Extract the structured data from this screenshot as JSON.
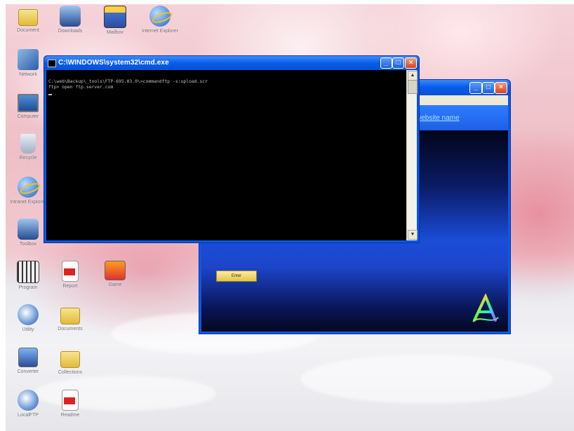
{
  "desktop": {
    "icons": [
      {
        "name": "folder-icon",
        "label": "Document"
      },
      {
        "name": "tool-icon",
        "label": "Downloads"
      },
      {
        "name": "msg-icon",
        "label": "Mailbox"
      },
      {
        "name": "ie-icon",
        "label": "Internet Explorer"
      },
      {
        "name": "network-icon",
        "label": "Network"
      },
      {
        "name": "monitor-icon",
        "label": "Computer"
      },
      {
        "name": "recycle-icon",
        "label": "Recycle"
      },
      {
        "name": "globe-icon",
        "label": "Intranet Explorer"
      },
      {
        "name": "tool2-icon",
        "label": "Toolbox"
      },
      {
        "name": "grid-icon",
        "label": "Program"
      },
      {
        "name": "doc-icon",
        "label": "Report"
      },
      {
        "name": "app-icon",
        "label": "Game"
      },
      {
        "name": "disc-icon",
        "label": "Utility"
      },
      {
        "name": "folder2-icon",
        "label": "Documents"
      },
      {
        "name": "app2-icon",
        "label": "Converter"
      },
      {
        "name": "folder3-icon",
        "label": "Collections"
      },
      {
        "name": "disc2-icon",
        "label": "LocalFTP"
      },
      {
        "name": "doc2-icon",
        "label": "Readme"
      }
    ]
  },
  "cmd": {
    "title": "C:\\WINDOWS\\system32\\cmd.exe",
    "lines": [
      "C:\\web\\Backup\\_tools\\FTP-695.03.0\\>commandftp -s:upload.scr",
      "ftp> open ftp.server.com"
    ],
    "buttons": {
      "minimize": "_",
      "maximize": "□",
      "close": "×"
    }
  },
  "appwin": {
    "link_text": "website name",
    "enter_label": "Enter",
    "buttons": {
      "minimize": "_",
      "maximize": "□",
      "close": "×"
    }
  },
  "colors": {
    "xp_title_blue": "#0a5de8",
    "console_bg": "#000000",
    "console_fg": "#c0c0c0"
  }
}
